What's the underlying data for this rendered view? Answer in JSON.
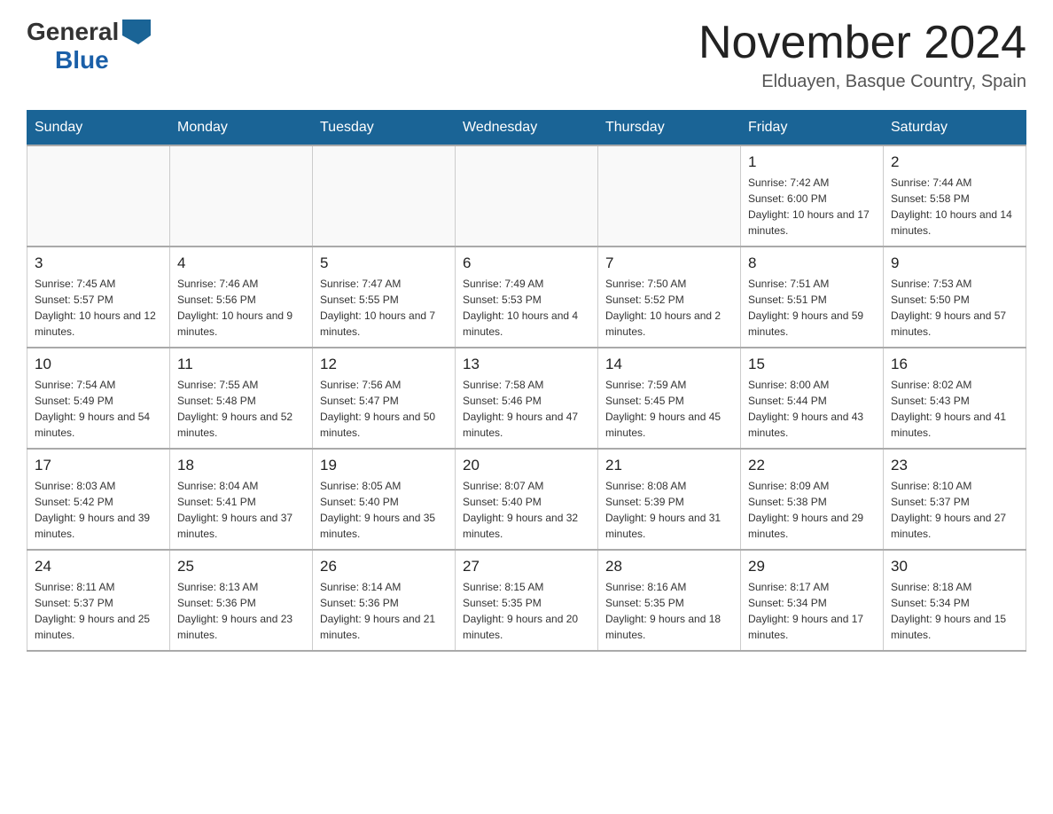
{
  "header": {
    "logo_general": "General",
    "logo_blue": "Blue",
    "month_title": "November 2024",
    "subtitle": "Elduayen, Basque Country, Spain"
  },
  "weekdays": [
    "Sunday",
    "Monday",
    "Tuesday",
    "Wednesday",
    "Thursday",
    "Friday",
    "Saturday"
  ],
  "weeks": [
    [
      {
        "num": "",
        "info": ""
      },
      {
        "num": "",
        "info": ""
      },
      {
        "num": "",
        "info": ""
      },
      {
        "num": "",
        "info": ""
      },
      {
        "num": "",
        "info": ""
      },
      {
        "num": "1",
        "info": "Sunrise: 7:42 AM\nSunset: 6:00 PM\nDaylight: 10 hours and 17 minutes."
      },
      {
        "num": "2",
        "info": "Sunrise: 7:44 AM\nSunset: 5:58 PM\nDaylight: 10 hours and 14 minutes."
      }
    ],
    [
      {
        "num": "3",
        "info": "Sunrise: 7:45 AM\nSunset: 5:57 PM\nDaylight: 10 hours and 12 minutes."
      },
      {
        "num": "4",
        "info": "Sunrise: 7:46 AM\nSunset: 5:56 PM\nDaylight: 10 hours and 9 minutes."
      },
      {
        "num": "5",
        "info": "Sunrise: 7:47 AM\nSunset: 5:55 PM\nDaylight: 10 hours and 7 minutes."
      },
      {
        "num": "6",
        "info": "Sunrise: 7:49 AM\nSunset: 5:53 PM\nDaylight: 10 hours and 4 minutes."
      },
      {
        "num": "7",
        "info": "Sunrise: 7:50 AM\nSunset: 5:52 PM\nDaylight: 10 hours and 2 minutes."
      },
      {
        "num": "8",
        "info": "Sunrise: 7:51 AM\nSunset: 5:51 PM\nDaylight: 9 hours and 59 minutes."
      },
      {
        "num": "9",
        "info": "Sunrise: 7:53 AM\nSunset: 5:50 PM\nDaylight: 9 hours and 57 minutes."
      }
    ],
    [
      {
        "num": "10",
        "info": "Sunrise: 7:54 AM\nSunset: 5:49 PM\nDaylight: 9 hours and 54 minutes."
      },
      {
        "num": "11",
        "info": "Sunrise: 7:55 AM\nSunset: 5:48 PM\nDaylight: 9 hours and 52 minutes."
      },
      {
        "num": "12",
        "info": "Sunrise: 7:56 AM\nSunset: 5:47 PM\nDaylight: 9 hours and 50 minutes."
      },
      {
        "num": "13",
        "info": "Sunrise: 7:58 AM\nSunset: 5:46 PM\nDaylight: 9 hours and 47 minutes."
      },
      {
        "num": "14",
        "info": "Sunrise: 7:59 AM\nSunset: 5:45 PM\nDaylight: 9 hours and 45 minutes."
      },
      {
        "num": "15",
        "info": "Sunrise: 8:00 AM\nSunset: 5:44 PM\nDaylight: 9 hours and 43 minutes."
      },
      {
        "num": "16",
        "info": "Sunrise: 8:02 AM\nSunset: 5:43 PM\nDaylight: 9 hours and 41 minutes."
      }
    ],
    [
      {
        "num": "17",
        "info": "Sunrise: 8:03 AM\nSunset: 5:42 PM\nDaylight: 9 hours and 39 minutes."
      },
      {
        "num": "18",
        "info": "Sunrise: 8:04 AM\nSunset: 5:41 PM\nDaylight: 9 hours and 37 minutes."
      },
      {
        "num": "19",
        "info": "Sunrise: 8:05 AM\nSunset: 5:40 PM\nDaylight: 9 hours and 35 minutes."
      },
      {
        "num": "20",
        "info": "Sunrise: 8:07 AM\nSunset: 5:40 PM\nDaylight: 9 hours and 32 minutes."
      },
      {
        "num": "21",
        "info": "Sunrise: 8:08 AM\nSunset: 5:39 PM\nDaylight: 9 hours and 31 minutes."
      },
      {
        "num": "22",
        "info": "Sunrise: 8:09 AM\nSunset: 5:38 PM\nDaylight: 9 hours and 29 minutes."
      },
      {
        "num": "23",
        "info": "Sunrise: 8:10 AM\nSunset: 5:37 PM\nDaylight: 9 hours and 27 minutes."
      }
    ],
    [
      {
        "num": "24",
        "info": "Sunrise: 8:11 AM\nSunset: 5:37 PM\nDaylight: 9 hours and 25 minutes."
      },
      {
        "num": "25",
        "info": "Sunrise: 8:13 AM\nSunset: 5:36 PM\nDaylight: 9 hours and 23 minutes."
      },
      {
        "num": "26",
        "info": "Sunrise: 8:14 AM\nSunset: 5:36 PM\nDaylight: 9 hours and 21 minutes."
      },
      {
        "num": "27",
        "info": "Sunrise: 8:15 AM\nSunset: 5:35 PM\nDaylight: 9 hours and 20 minutes."
      },
      {
        "num": "28",
        "info": "Sunrise: 8:16 AM\nSunset: 5:35 PM\nDaylight: 9 hours and 18 minutes."
      },
      {
        "num": "29",
        "info": "Sunrise: 8:17 AM\nSunset: 5:34 PM\nDaylight: 9 hours and 17 minutes."
      },
      {
        "num": "30",
        "info": "Sunrise: 8:18 AM\nSunset: 5:34 PM\nDaylight: 9 hours and 15 minutes."
      }
    ]
  ]
}
